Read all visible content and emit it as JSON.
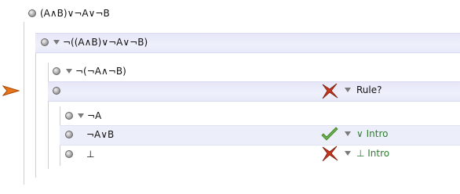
{
  "proof": {
    "root_formula": "(A∧B)∨¬A∨¬B",
    "assumption_formula": "¬((A∧B)∨¬A∨¬B)",
    "subgoal_formula": "¬(¬A∧¬B)",
    "empty_goal_rule": "Rule?",
    "subassumption_formula": "¬A",
    "derived_formula": "¬A∨B",
    "derived_rule": "∨ Intro",
    "bottom_formula": "⊥",
    "bottom_rule": "⊥ Intro"
  },
  "icons": {
    "current_step": "orange-arrow-icon",
    "error": "red-cross-icon",
    "ok": "green-checkmark-icon",
    "node": "grey-bullet-icon",
    "menu": "dropdown-triangle-icon"
  }
}
